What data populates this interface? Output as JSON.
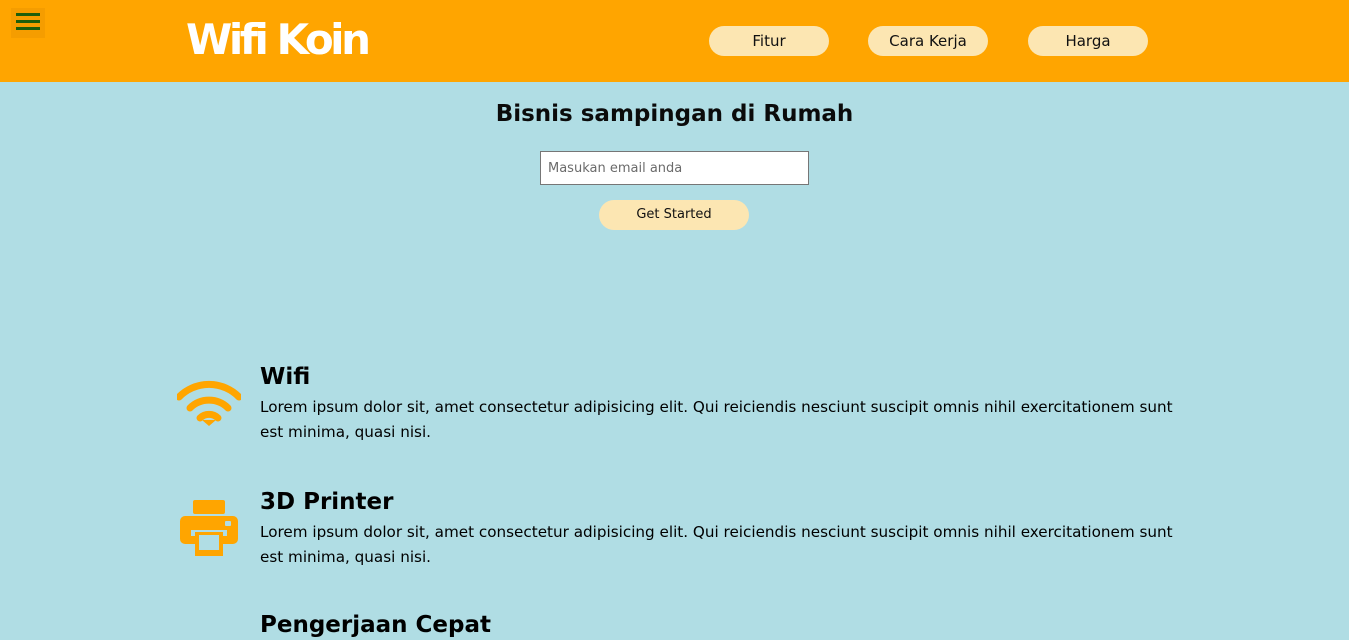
{
  "header": {
    "logo": "Wifi Koin",
    "menu_icon": "hamburger-menu-icon",
    "nav": [
      "Fitur",
      "Cara Kerja",
      "Harga"
    ],
    "background_color": "#ffa500",
    "nav_button_color": "#fce6b2"
  },
  "hero": {
    "title": "Bisnis sampingan di Rumah",
    "email_placeholder": "Masukan email anda",
    "cta_label": "Get Started"
  },
  "features": [
    {
      "icon": "wifi-icon",
      "title": "Wifi",
      "description": "Lorem ipsum dolor sit, amet consectetur adipisicing elit. Qui reiciendis nesciunt suscipit omnis nihil exercitationem sunt est minima, quasi nisi."
    },
    {
      "icon": "printer-icon",
      "title": "3D Printer",
      "description": "Lorem ipsum dolor sit, amet consectetur adipisicing elit. Qui reiciendis nesciunt suscipit omnis nihil exercitationem sunt est minima, quasi nisi."
    },
    {
      "icon": "",
      "title": "Pengerjaan Cepat",
      "description": ""
    }
  ],
  "colors": {
    "page_background": "#b0dde4",
    "icon_color": "#ffa500"
  }
}
